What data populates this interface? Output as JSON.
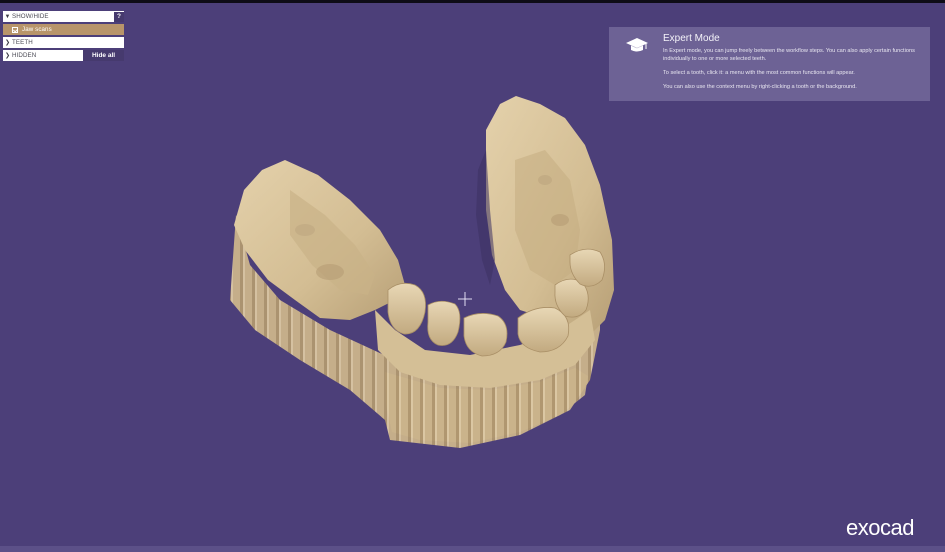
{
  "panel": {
    "show_hide_label": "SHOW/HIDE",
    "help_label": "?",
    "jaw_scans_label": "Jaw scans",
    "teeth_label": "TEETH",
    "hidden_label": "HIDDEN",
    "hide_all_label": "Hide all"
  },
  "expert": {
    "title": "Expert Mode",
    "para1": "In Expert mode, you can jump freely between the workflow steps. You can also apply certain functions individually to one or more selected teeth.",
    "para2": "To select a tooth, click it: a menu with the most common functions will appear.",
    "para3": "You can also use the context menu by right-clicking a tooth or the background.",
    "icon": "graduation-cap-icon"
  },
  "brand": {
    "logo": "exocad"
  },
  "colors": {
    "viewport_bg": "#4c3f79",
    "model": "#d8c39b",
    "jaw_row": "#b8956a",
    "button_bg": "#463a6e",
    "panel_bg": "#6d6295"
  }
}
